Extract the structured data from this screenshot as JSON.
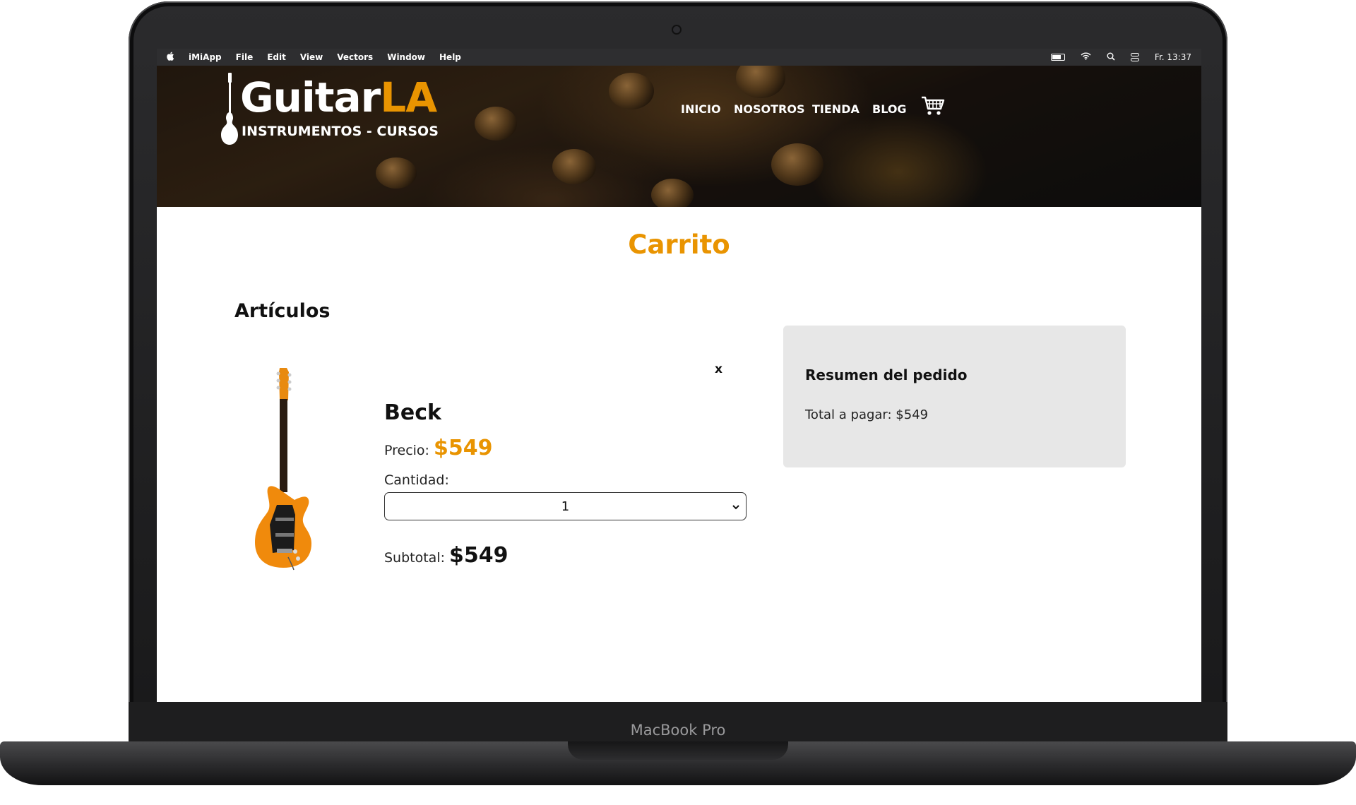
{
  "device": {
    "model": "MacBook Pro"
  },
  "menubar": {
    "app": "iMiApp",
    "items": [
      "File",
      "Edit",
      "View",
      "Vectors",
      "Window",
      "Help"
    ],
    "clock": "Fr. 13:37"
  },
  "site": {
    "logo": {
      "word_main": "Guitar",
      "word_accent": "LA",
      "tagline": "INSTRUMENTOS - CURSOS"
    },
    "nav": [
      "INICIO",
      "NOSOTROS",
      "TIENDA",
      "BLOG"
    ]
  },
  "page": {
    "title": "Carrito",
    "articles_heading": "Artículos",
    "remove_label": "x"
  },
  "cart_item": {
    "name": "Beck",
    "price_label": "Precio:",
    "price": "$549",
    "quantity_label": "Cantidad:",
    "quantity": "1",
    "subtotal_label": "Subtotal:",
    "subtotal": "$549"
  },
  "summary": {
    "title": "Resumen del pedido",
    "total_text": "Total a pagar: $549"
  },
  "colors": {
    "accent": "#e99401"
  }
}
